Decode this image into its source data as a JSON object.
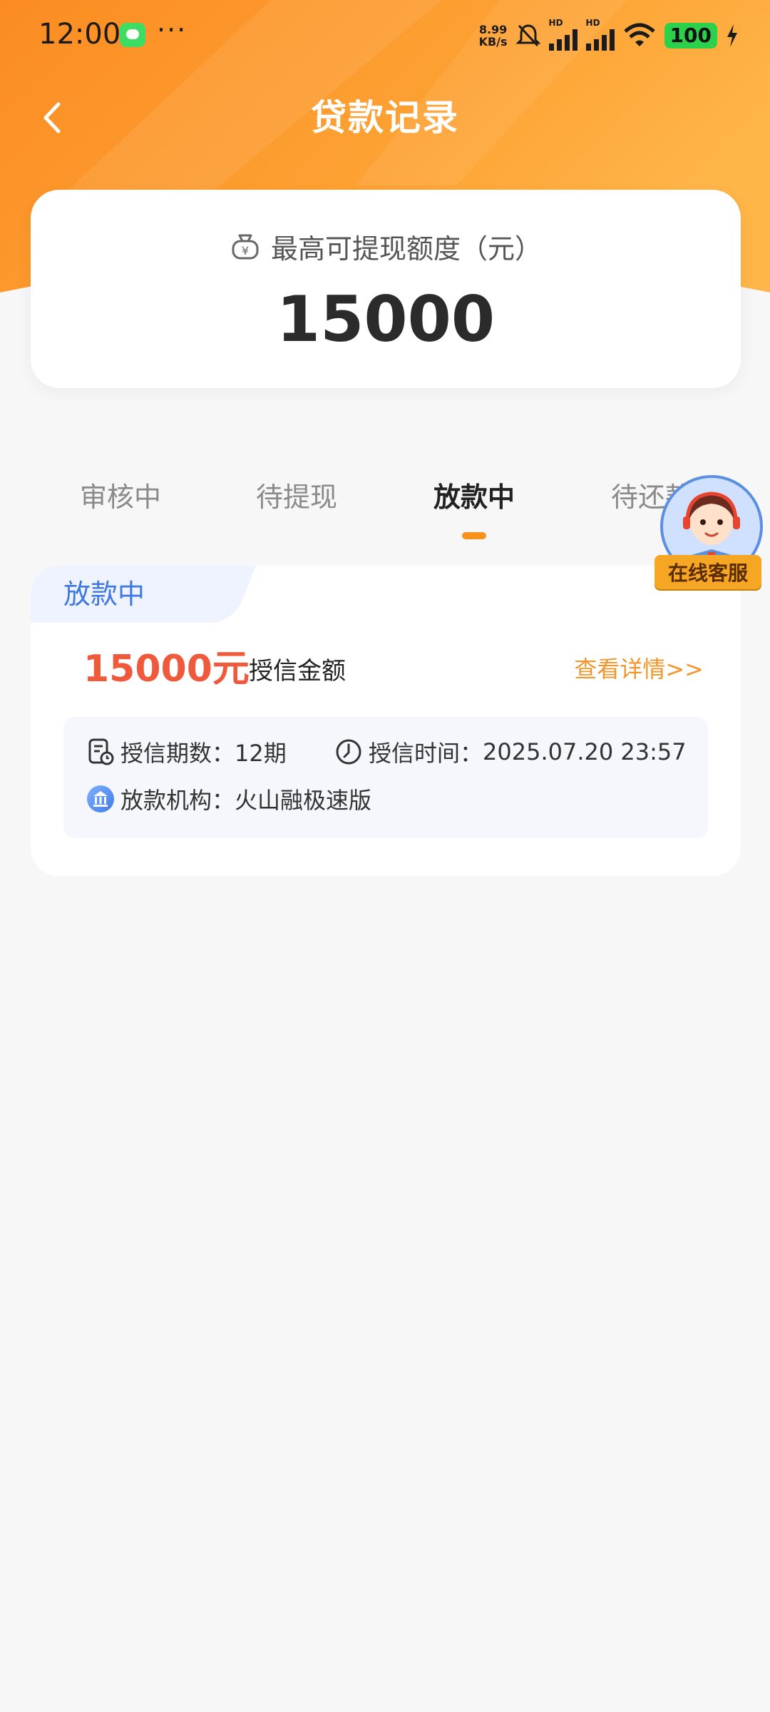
{
  "status_bar": {
    "time": "12:00",
    "more": "···",
    "net_speed_value": "8.99",
    "net_speed_unit": "KB/s",
    "sim1_label": "HD",
    "sim2_label": "HD",
    "battery": "100"
  },
  "header": {
    "title": "贷款记录"
  },
  "quota": {
    "label": "最高可提现额度（元）",
    "value": "15000"
  },
  "tabs": [
    {
      "label": "审核中"
    },
    {
      "label": "待提现"
    },
    {
      "label": "放款中"
    },
    {
      "label": "待还款"
    }
  ],
  "active_tab": "放款中",
  "loan": {
    "status": "放款中",
    "amount": "15000元",
    "amount_label": "授信金额",
    "detail_link": "查看详情>>",
    "period_label": "授信期数：",
    "period_value": "12期",
    "time_label": "授信时间：",
    "time_value": "2025.07.20 23:57",
    "institution_label": "放款机构：",
    "institution_value": "火山融极速版"
  },
  "customer_service": {
    "label": "在线客服"
  },
  "colors": {
    "header_orange": "#fb9a2a",
    "amount_red": "#f05a3c",
    "link_orange": "#f0962a",
    "tag_blue": "#3e78e0"
  }
}
